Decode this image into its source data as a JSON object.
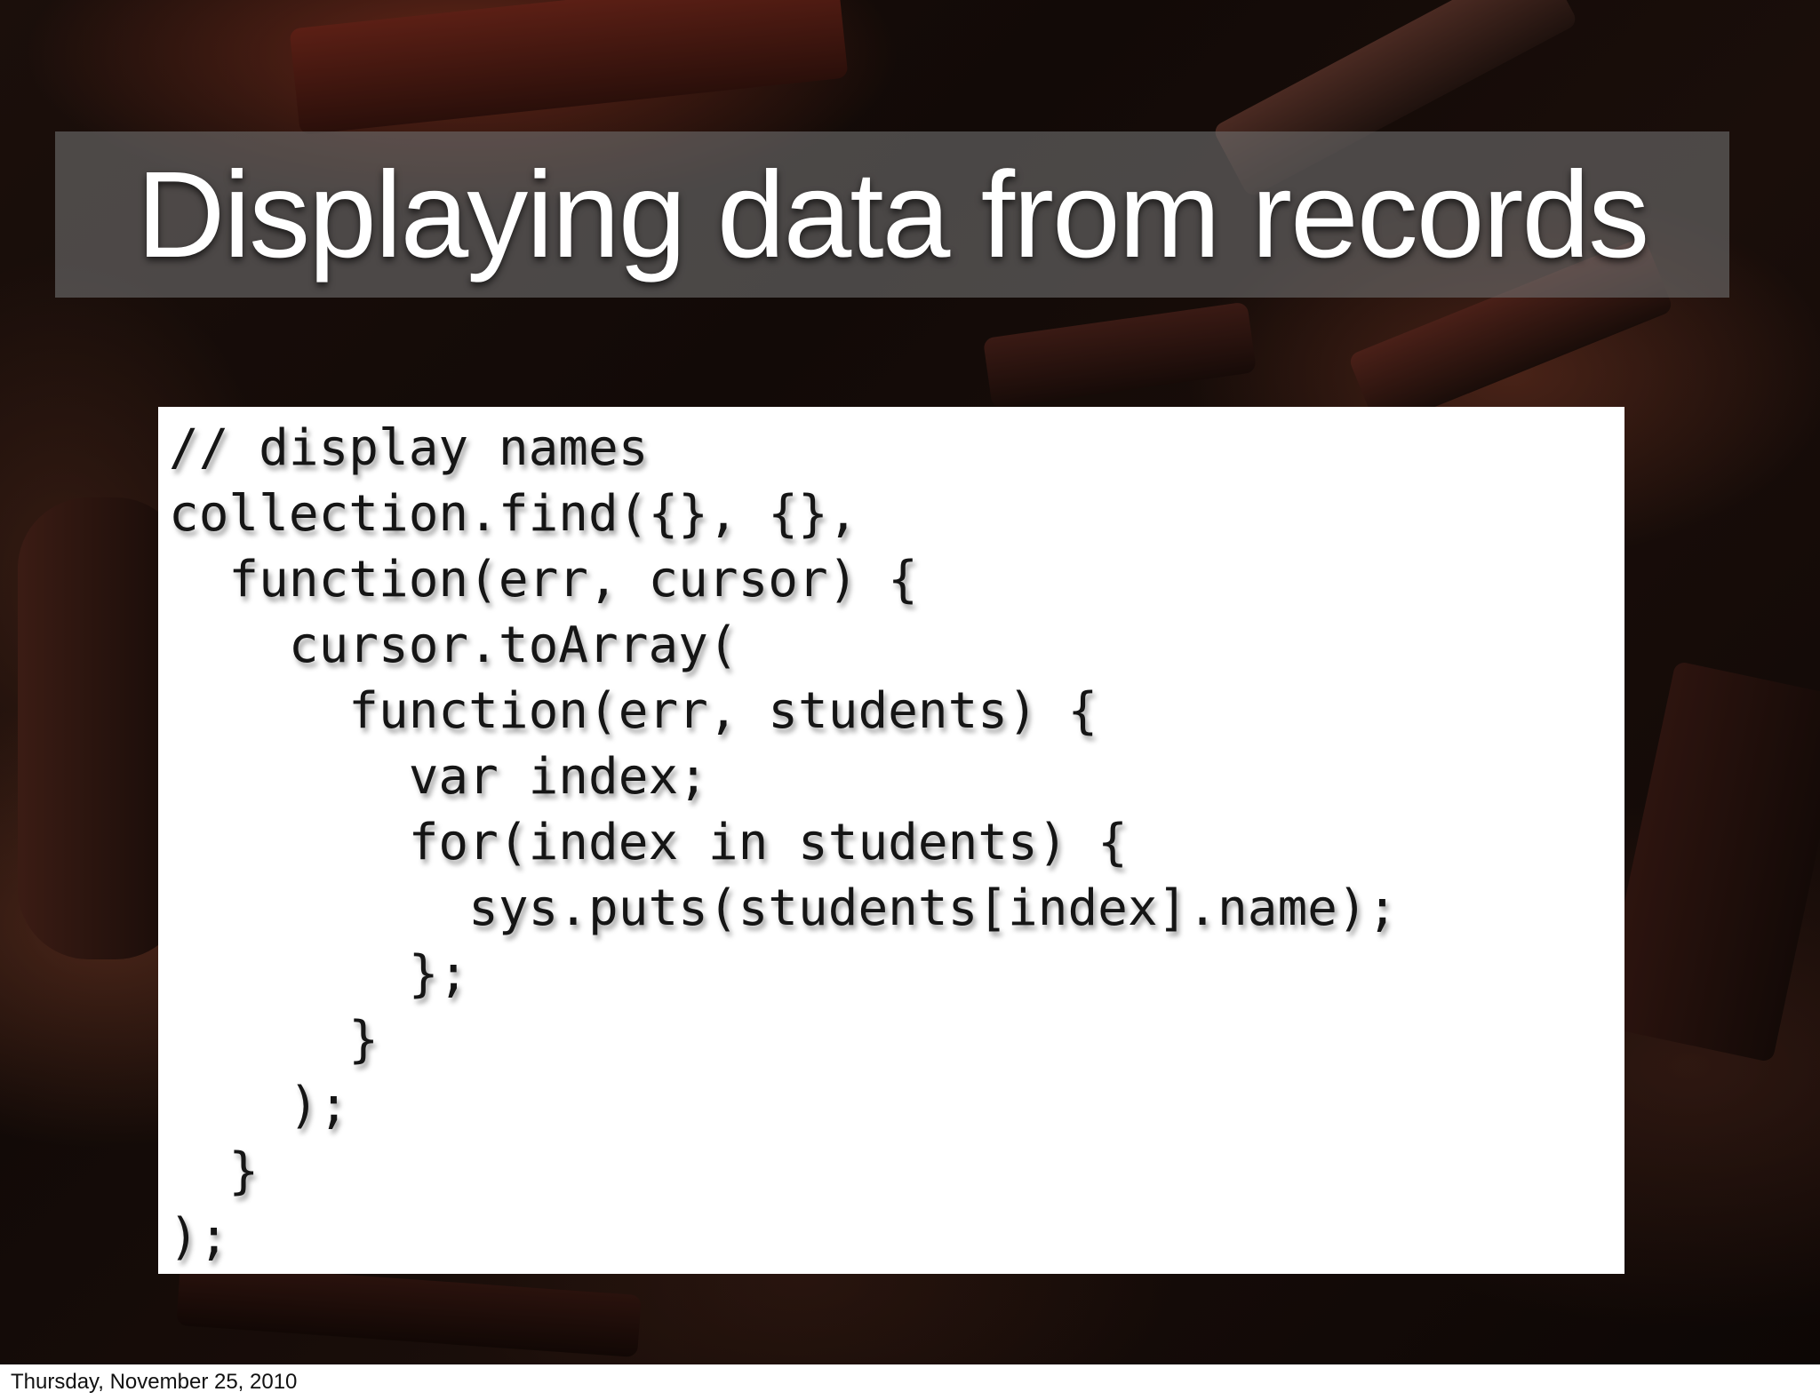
{
  "slide": {
    "title": "Displaying data from records",
    "code_lines": [
      "// display names",
      "collection.find({}, {},",
      "  function(err, cursor) {",
      "    cursor.toArray(",
      "      function(err, students) {",
      "        var index;",
      "        for(index in students) {",
      "          sys.puts(students[index].name);",
      "        };",
      "      }",
      "    );",
      "  }",
      ");"
    ],
    "footer_date": "Thursday, November 25, 2010"
  },
  "colors": {
    "title_text": "#ffffff",
    "title_band": "#6e6e6e",
    "code_background": "#ffffff",
    "code_text": "#151515",
    "page_background": "#ffffff"
  }
}
